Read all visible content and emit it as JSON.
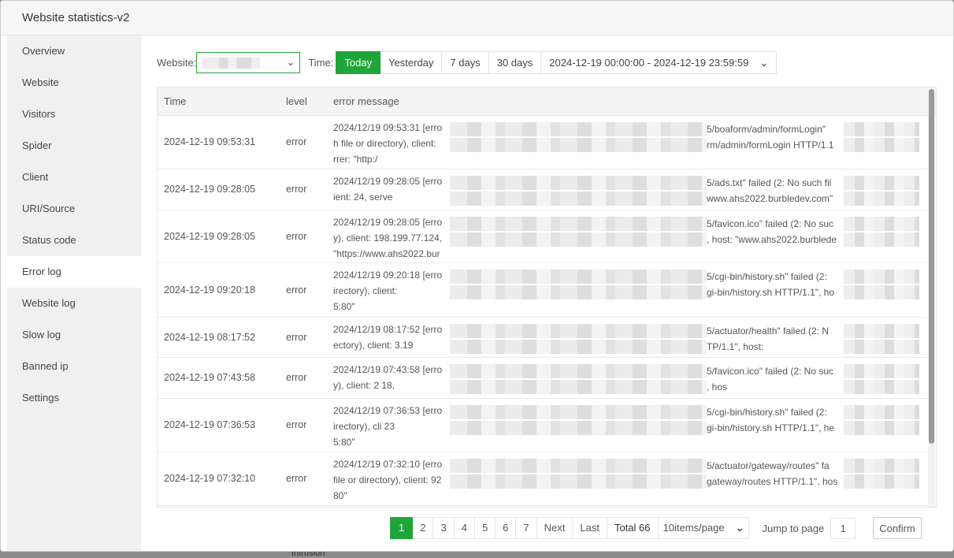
{
  "window": {
    "title": "Website statistics-v2"
  },
  "sidebar": {
    "items": [
      {
        "label": "Overview"
      },
      {
        "label": "Website"
      },
      {
        "label": "Visitors"
      },
      {
        "label": "Spider"
      },
      {
        "label": "Client"
      },
      {
        "label": "URI/Source"
      },
      {
        "label": "Status code"
      },
      {
        "label": "Error log",
        "active": true
      },
      {
        "label": "Website log"
      },
      {
        "label": "Slow log"
      },
      {
        "label": "Banned ip"
      },
      {
        "label": "Settings"
      }
    ]
  },
  "toolbar": {
    "website_label": "Website:",
    "time_label": "Time:",
    "buttons": [
      "Today",
      "Yesterday",
      "7 days",
      "30 days"
    ],
    "active": "Today",
    "date_start": "2024-12-19 00:00:00",
    "date_sep": "-",
    "date_end": "2024-12-19 23:59:59",
    "accent": "#20a53a"
  },
  "table": {
    "headers": [
      "Time",
      "level",
      "error message"
    ],
    "rows": [
      {
        "time": "2024-12-19 09:53:31",
        "level": "error",
        "lines": [
          [
            "2024/12/19 09:53:31 [erro",
            "5/boaform/admin/formLogin\""
          ],
          [
            "h file or directory), client:",
            "rm/admin/formLogin HTTP/1.1"
          ],
          [
            "          rrer: \"http:/",
            ""
          ]
        ]
      },
      {
        "time": "2024-12-19 09:28:05",
        "level": "error",
        "lines": [
          [
            "2024/12/19 09:28:05 [erro",
            "5/ads.txt\" failed (2: No such fil"
          ],
          [
            "ient:        24, serve",
            "www.ahs2022.burbledev.com\""
          ]
        ]
      },
      {
        "time": "2024-12-19 09:28:05",
        "level": "error",
        "lines": [
          [
            "2024/12/19 09:28:05 [erro",
            "5/favicon.ico\" failed (2: No suc"
          ],
          [
            "y), client: 198.199.77.124,",
            ", host: \"www.ahs2022.burblede"
          ],
          [
            "\"https://www.ahs2022.bur",
            ""
          ]
        ]
      },
      {
        "time": "2024-12-19 09:20:18",
        "level": "error",
        "lines": [
          [
            "2024/12/19 09:20:18 [erro",
            "5/cgi-bin/history.sh\" failed (2:"
          ],
          [
            "irectory), client:",
            "gi-bin/history.sh HTTP/1.1\", ho"
          ],
          [
            "5:80\"",
            ""
          ]
        ]
      },
      {
        "time": "2024-12-19 08:17:52",
        "level": "error",
        "lines": [
          [
            "2024/12/19 08:17:52 [erro",
            "5/actuator/health\" failed (2: N"
          ],
          [
            "ectory), client:      3.19",
            "TP/1.1\", host:"
          ]
        ]
      },
      {
        "time": "2024-12-19 07:43:58",
        "level": "error",
        "lines": [
          [
            "2024/12/19 07:43:58 [erro",
            "5/favicon.ico\" failed (2: No suc"
          ],
          [
            "y), client: 2        18,",
            ", hos"
          ]
        ]
      },
      {
        "time": "2024-12-19 07:36:53",
        "level": "error",
        "lines": [
          [
            "2024/12/19 07:36:53 [erro",
            "5/cgi-bin/history.sh\" failed (2:"
          ],
          [
            "irectory), cli       23",
            "gi-bin/history.sh HTTP/1.1\", he"
          ],
          [
            "5:80\"",
            ""
          ]
        ]
      },
      {
        "time": "2024-12-19 07:32:10",
        "level": "error",
        "lines": [
          [
            "2024/12/19 07:32:10 [erro",
            "5/actuator/gateway/routes\" fa"
          ],
          [
            "file or directory), client: 92",
            "gateway/routes HTTP/1.1\", hos"
          ],
          [
            "80\"",
            ""
          ]
        ]
      }
    ]
  },
  "pagination": {
    "pages": [
      "1",
      "2",
      "3",
      "4",
      "5",
      "6",
      "7"
    ],
    "current": "1",
    "next": "Next",
    "last": "Last",
    "total": "Total 66",
    "page_size": "10items/page",
    "jump_label": "Jump to page",
    "jump_value": "1",
    "confirm": "Confirm"
  },
  "background": {
    "partial_text": "Intrusion"
  }
}
